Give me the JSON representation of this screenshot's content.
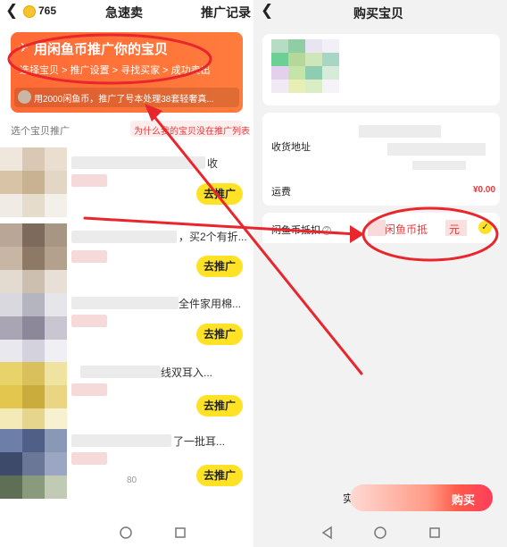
{
  "left": {
    "coin_count": "765",
    "title": "急速卖",
    "promo_records": "推广记录",
    "banner": {
      "title": "用闲鱼币推广你的宝贝",
      "steps": "选择宝贝 > 推广设置 > 寻找买家 > 成功卖出",
      "stats": "用2000闲鱼币，推广了号本处理38套轻奢真..."
    },
    "select_label": "选个宝贝推广",
    "why_link": "为什么我的宝贝没在推广列表",
    "items": [
      {
        "title": "收",
        "button": "去推广"
      },
      {
        "title": "，买2个有折...",
        "button": "去推广"
      },
      {
        "title": "全件家用棉...",
        "button": "去推广"
      },
      {
        "title": "线双耳入...",
        "button": "去推广"
      },
      {
        "title": "了一批耳...",
        "button": "去推广"
      }
    ],
    "item5_extra": "80"
  },
  "right": {
    "title": "购买宝贝",
    "address_label": "收货地址",
    "shipping_label": "运费",
    "shipping_value": "¥0.00",
    "coin_deduct_label": "闲鱼币抵扣",
    "coin_deduct_value": "闲鱼币抵",
    "coin_deduct_unit": "元",
    "buy_prefix": "实",
    "buy_button": "购买"
  },
  "colors": {
    "banner": "#ff6a35",
    "accent_red": "#e4393c",
    "button_yellow": "#ffe225",
    "annotation_red": "#e8262c"
  }
}
